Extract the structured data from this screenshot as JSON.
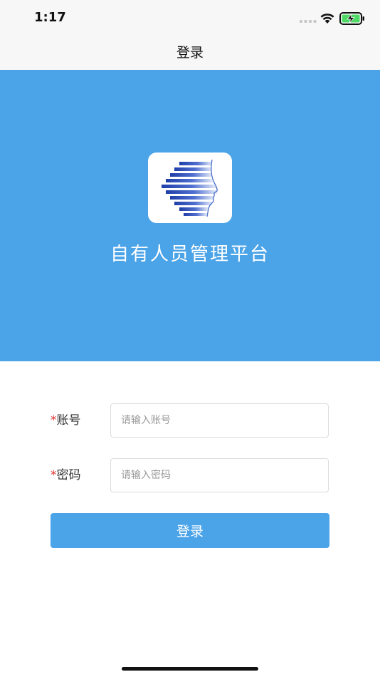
{
  "status_bar": {
    "time": "1:17",
    "signal_icon": "signal-dots-icon",
    "wifi_icon": "wifi-icon",
    "battery_icon": "battery-charging-icon",
    "battery_color": "#4cd964"
  },
  "nav": {
    "title": "登录"
  },
  "hero": {
    "background": "#4ba3e8",
    "logo_icon": "face-profile-logo",
    "title": "自有人员管理平台"
  },
  "form": {
    "account": {
      "required_mark": "*",
      "label": "账号",
      "placeholder": "请输入账号",
      "value": ""
    },
    "password": {
      "required_mark": "*",
      "label": "密码",
      "placeholder": "请输入密码",
      "value": ""
    },
    "submit_label": "登录"
  },
  "colors": {
    "accent": "#4ba3e8",
    "required": "#e03131"
  }
}
